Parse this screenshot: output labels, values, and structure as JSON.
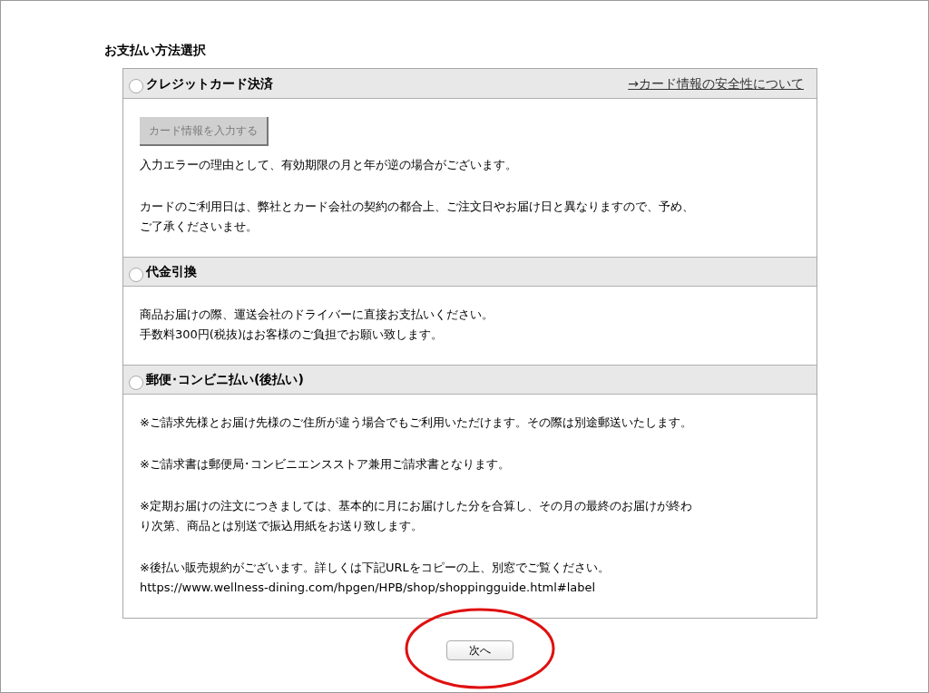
{
  "title": "お支払い方法選択",
  "sections": [
    {
      "label": "クレジットカード決済",
      "selected": false,
      "link": "→カード情報の安全性について",
      "button": {
        "label": "カード情報を入力する",
        "disabled": true
      },
      "paragraphs": [
        {
          "lines": [
            "入力エラーの理由として、有効期限の月と年が逆の場合がございます。"
          ]
        },
        {
          "lines": [
            "カードのご利用日は、弊社とカード会社の契約の都合上、ご注文日やお届け日と異なりますので、予め、",
            "ご了承くださいませ。"
          ]
        }
      ]
    },
    {
      "label": "代金引換",
      "selected": false,
      "paragraphs": [
        {
          "lines": [
            "商品お届けの際、運送会社のドライバーに直接お支払いください。",
            "手数料300円(税抜)はお客様のご負担でお願い致します。"
          ]
        }
      ]
    },
    {
      "label": "郵便･コンビニ払い(後払い)",
      "selected": false,
      "paragraphs": [
        {
          "lines": [
            "※ご請求先様とお届け先様のご住所が違う場合でもご利用いただけます。その際は別途郵送いたします。"
          ]
        },
        {
          "lines": [
            "※ご請求書は郵便局･コンビニエンスストア兼用ご請求書となります。"
          ]
        },
        {
          "lines": [
            "※定期お届けの注文につきましては、基本的に月にお届けした分を合算し、その月の最終のお届けが終わ",
            "り次第、商品とは別送で振込用紙をお送り致します。"
          ]
        },
        {
          "lines": [
            "※後払い販売規約がございます。詳しくは下記URLをコピーの上、別窓でご覧ください。",
            "https://www.wellness-dining.com/hpgen/HPB/shop/shoppingguide.html#label"
          ]
        }
      ]
    }
  ],
  "next_button": "次へ"
}
